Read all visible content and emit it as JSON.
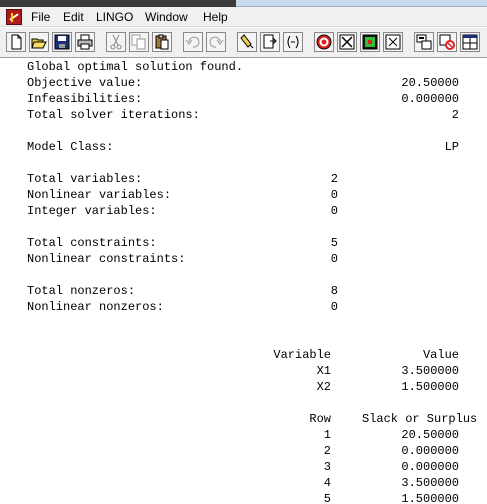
{
  "menu": [
    "File",
    "Edit",
    "LINGO",
    "Window",
    "Help"
  ],
  "toolbar": {
    "buttons": [
      "new-icon",
      "open-icon",
      "save-icon",
      "print-icon",
      "cut-icon",
      "copy-icon",
      "paste-icon",
      "undo-icon",
      "redo-icon",
      "find-icon",
      "goto-line-icon",
      "match-paren-icon",
      "solve-icon",
      "close-all-icon",
      "model-icon",
      "close-window-icon",
      "options-icon",
      "tile-icon",
      "cascade-icon"
    ]
  },
  "report": {
    "status": "Global optimal solution found.",
    "objective_label": "Objective value:",
    "objective_value": "20.50000",
    "infeas_label": "Infeasibilities:",
    "infeas_value": "0.000000",
    "iters_label": "Total solver iterations:",
    "iters_value": "2",
    "model_class_label": "Model Class:",
    "model_class_value": "LP",
    "total_vars_label": "Total variables:",
    "total_vars_value": "2",
    "nonlin_vars_label": "Nonlinear variables:",
    "nonlin_vars_value": "0",
    "int_vars_label": "Integer variables:",
    "int_vars_value": "0",
    "total_cons_label": "Total constraints:",
    "total_cons_value": "5",
    "nonlin_cons_label": "Nonlinear constraints:",
    "nonlin_cons_value": "0",
    "total_nz_label": "Total nonzeros:",
    "total_nz_value": "8",
    "nonlin_nz_label": "Nonlinear nonzeros:",
    "nonlin_nz_value": "0",
    "var_header": "Variable",
    "value_header": "Value",
    "variables": [
      {
        "name": "X1",
        "value": "3.500000"
      },
      {
        "name": "X2",
        "value": "1.500000"
      }
    ],
    "row_header": "Row",
    "slack_header": "Slack or Surplus",
    "rows": [
      {
        "row": "1",
        "slack": "20.50000"
      },
      {
        "row": "2",
        "slack": "0.000000"
      },
      {
        "row": "3",
        "slack": "0.000000"
      },
      {
        "row": "4",
        "slack": "3.500000"
      },
      {
        "row": "5",
        "slack": "1.500000"
      }
    ]
  }
}
